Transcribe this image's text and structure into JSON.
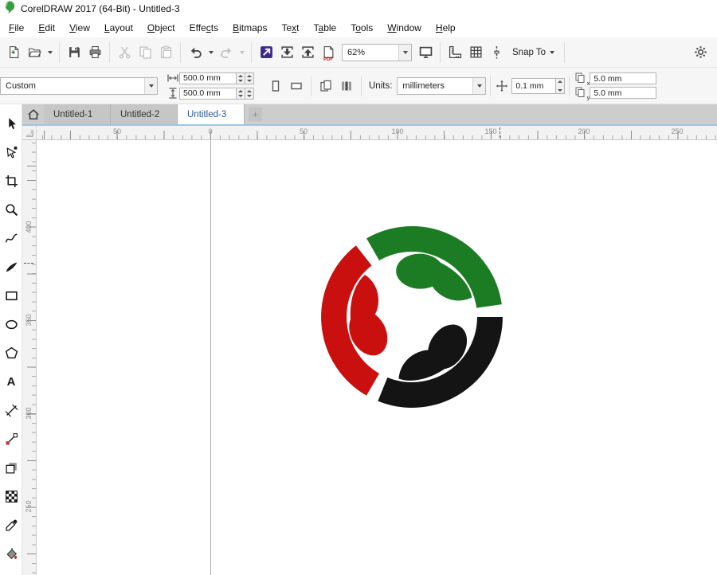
{
  "window": {
    "title": "CorelDRAW 2017 (64-Bit) - Untitled-3"
  },
  "menu": {
    "items": [
      {
        "pre": "",
        "key": "F",
        "post": "ile"
      },
      {
        "pre": "",
        "key": "E",
        "post": "dit"
      },
      {
        "pre": "",
        "key": "V",
        "post": "iew"
      },
      {
        "pre": "",
        "key": "L",
        "post": "ayout"
      },
      {
        "pre": "",
        "key": "O",
        "post": "bject"
      },
      {
        "pre": "Effe",
        "key": "c",
        "post": "ts"
      },
      {
        "pre": "",
        "key": "B",
        "post": "itmaps"
      },
      {
        "pre": "Te",
        "key": "x",
        "post": "t"
      },
      {
        "pre": "T",
        "key": "a",
        "post": "ble"
      },
      {
        "pre": "T",
        "key": "o",
        "post": "ols"
      },
      {
        "pre": "",
        "key": "W",
        "post": "indow"
      },
      {
        "pre": "",
        "key": "H",
        "post": "elp"
      }
    ]
  },
  "toolbar": {
    "zoom_value": "62%",
    "pdf_label": "PDF",
    "snap_label": "Snap To"
  },
  "propbar": {
    "preset": "Custom",
    "page_width": "500.0 mm",
    "page_height": "500.0 mm",
    "units_label": "Units:",
    "units_value": "millimeters",
    "nudge_value": "0.1 mm",
    "duplicate_x": "5.0 mm",
    "duplicate_y": "5.0 mm",
    "dup_x_sub": "x",
    "dup_y_sub": "y"
  },
  "tabs": {
    "items": [
      "Untitled-1",
      "Untitled-2",
      "Untitled-3"
    ],
    "add_label": "+"
  },
  "rulers": {
    "h": [
      "50",
      "0",
      "50",
      "100",
      "150",
      "200",
      "250"
    ],
    "v": [
      "400",
      "350",
      "300",
      "250"
    ]
  },
  "toolbox": {
    "tools": [
      "Pick tool",
      "Shape tool",
      "Crop tool",
      "Zoom tool",
      "Freehand tool",
      "Artistic media tool",
      "Rectangle tool",
      "Ellipse tool",
      "Polygon tool",
      "Text tool",
      "Parallel dimension tool",
      "Connector tool",
      "Drop shadow tool",
      "Transparency tool",
      "Color eyedropper tool",
      "Interactive fill tool"
    ],
    "text_tool_glyph": "A"
  },
  "logo": {
    "green": "#1c7c24",
    "red": "#c9100f",
    "black": "#141414"
  }
}
